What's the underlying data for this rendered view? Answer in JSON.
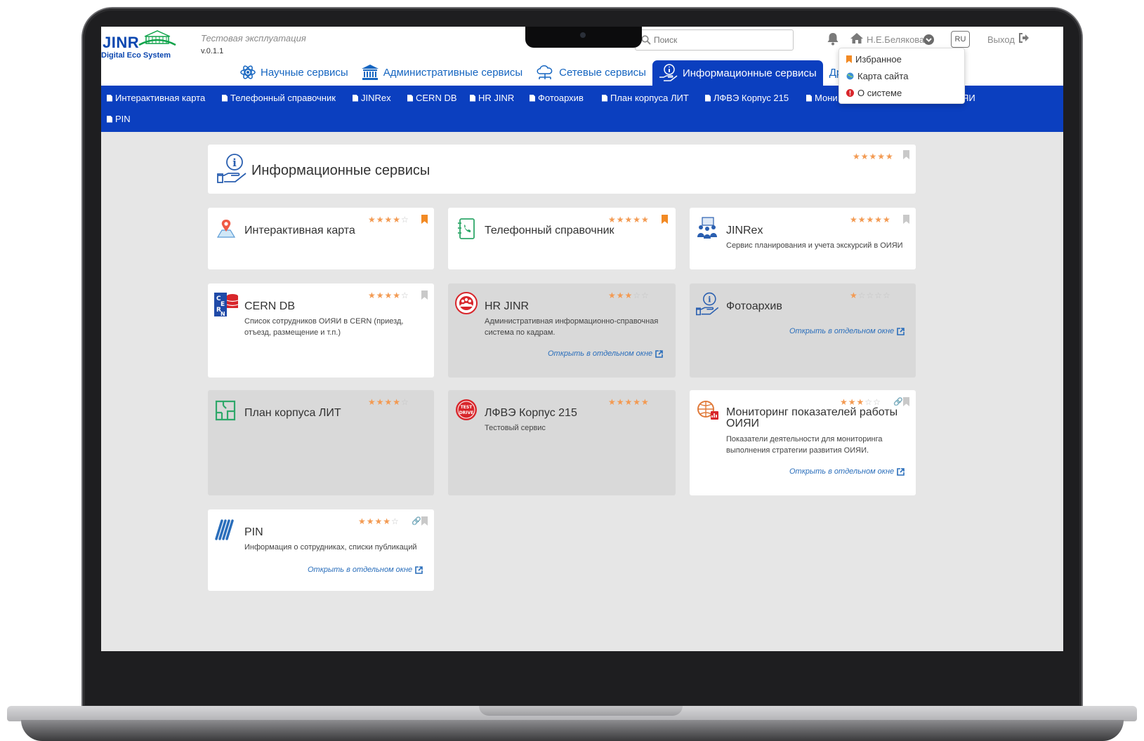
{
  "app": {
    "logo_text": "JINR",
    "logo_sub": "Digital Eco System",
    "environment": "Тестовая эксплуатация",
    "version": "v.0.1.1"
  },
  "search": {
    "placeholder": "Поиск"
  },
  "user": {
    "name": "Н.Е.Белякова",
    "lang": "RU",
    "logout": "Выход"
  },
  "tabs": [
    {
      "label": "Научные сервисы",
      "icon": "atom-icon",
      "active": false
    },
    {
      "label": "Административные сервисы",
      "icon": "institution-icon",
      "active": false
    },
    {
      "label": "Сетевые сервисы",
      "icon": "cloud-network-icon",
      "active": false
    },
    {
      "label": "Информационные сервисы",
      "icon": "info-hand-icon",
      "active": true
    },
    {
      "label": "Другие с",
      "icon": "",
      "active": false
    }
  ],
  "service_nav": [
    "Интерактивная карта",
    "Телефонный справочник",
    "JINRex",
    "CERN DB",
    "HR JINR",
    "Фотоархив",
    "План корпуса ЛИТ",
    "ЛФВЭ Корпус 215",
    "Мони",
    "ЯИ",
    "PIN"
  ],
  "user_menu": [
    {
      "label": "Избранное",
      "icon": "bookmark-icon",
      "color": "#f28a24"
    },
    {
      "label": "Карта сайта",
      "icon": "globe-icon",
      "color": "#3a8fd6"
    },
    {
      "label": "О системе",
      "icon": "info-circle-icon",
      "color": "#d9262b"
    }
  ],
  "section": {
    "title": "Информационные сервисы",
    "rating": 5,
    "favorite": false
  },
  "cards": [
    {
      "title": "Интерактивная карта",
      "desc": "",
      "rating": 4,
      "favorite": true,
      "link": ""
    },
    {
      "title": "Телефонный справочник",
      "desc": "",
      "rating": 5,
      "favorite": true,
      "link": ""
    },
    {
      "title": "JINRex",
      "desc": "Сервис планирования и учета экскурсий в ОИЯИ",
      "rating": 5,
      "favorite": false,
      "link": ""
    },
    {
      "title": "CERN DB",
      "desc": "Список сотрудников ОИЯИ в CERN (приезд, отъезд, размещение и т.п.)",
      "rating": 4,
      "favorite": false,
      "link": ""
    },
    {
      "title": "HR JINR",
      "desc": "Административная информационно-справочная система по кадрам.",
      "rating": 3,
      "favorite": false,
      "link": "Открыть в отдельном окне"
    },
    {
      "title": "Фотоархив",
      "desc": "",
      "rating": 1,
      "favorite": false,
      "link": "Открыть в отдельном окне"
    },
    {
      "title": "План корпуса ЛИТ",
      "desc": "",
      "rating": 4,
      "favorite": false,
      "link": ""
    },
    {
      "title": "ЛФВЭ Корпус 215",
      "desc": "Тестовый сервис",
      "rating": 5,
      "favorite": false,
      "link": ""
    },
    {
      "title": "Мониторинг показателей работы ОИЯИ",
      "desc": "Показатели деятельности для мониторинга выполнения стратегии развития ОИЯИ.",
      "rating": 3,
      "favorite": false,
      "link": "Открыть в отдельном окне"
    },
    {
      "title": "PIN",
      "desc": "Информация о сотрудниках, списки публикаций",
      "rating": 4,
      "favorite": false,
      "link": "Открыть в отдельном окне"
    }
  ],
  "colors": {
    "accent": "#0b3fbf",
    "star": "#f39a52",
    "favorite": "#f28a24",
    "link": "#2a6ebb"
  }
}
